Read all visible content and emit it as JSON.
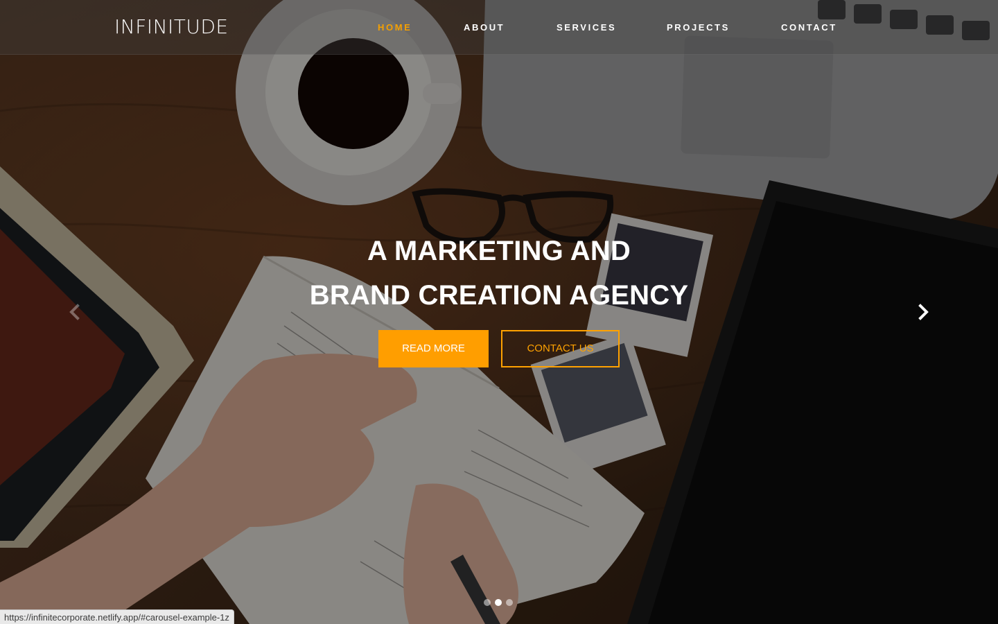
{
  "brand": {
    "logo_text": "INFINITUDE"
  },
  "nav": {
    "items": [
      {
        "label": "HOME",
        "active": true
      },
      {
        "label": "ABOUT",
        "active": false
      },
      {
        "label": "SERVICES",
        "active": false
      },
      {
        "label": "PROJECTS",
        "active": false
      },
      {
        "label": "CONTACT",
        "active": false
      }
    ]
  },
  "hero": {
    "headline_line1": "A MARKETING AND",
    "headline_line2": "BRAND CREATION AGENCY",
    "read_more_label": "READ MORE",
    "contact_label": "CONTACT US"
  },
  "carousel": {
    "prev_icon": "chevron-left-icon",
    "next_icon": "chevron-right-icon",
    "slide_count": 3,
    "active_slide": 2
  },
  "status_bar": {
    "url": "https://infinitecorporate.netlify.app/#carousel-example-1z"
  },
  "colors": {
    "accent": "#ff9e00",
    "nav_active": "#f5a000",
    "text": "#ffffff"
  }
}
